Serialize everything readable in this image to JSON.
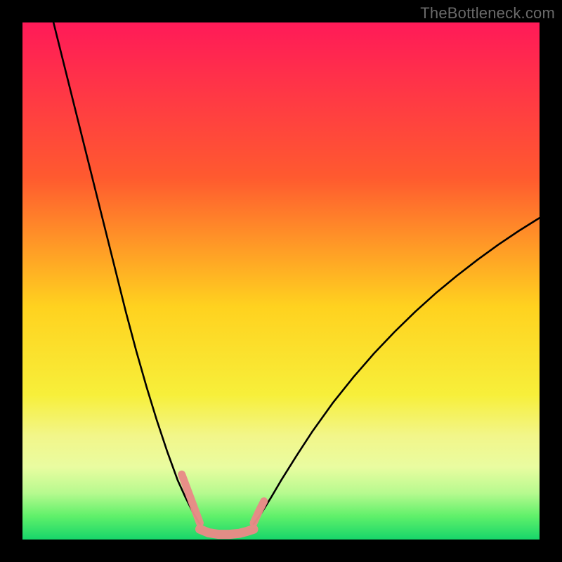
{
  "watermark": "TheBottleneck.com",
  "chart_data": {
    "type": "line",
    "title": "",
    "xlabel": "",
    "ylabel": "",
    "xlim": [
      0,
      100
    ],
    "ylim": [
      0,
      100
    ],
    "grid": false,
    "legend": false,
    "annotations": [],
    "background_gradient_stops": [
      {
        "offset": 0.0,
        "color": "#ff1a58"
      },
      {
        "offset": 0.3,
        "color": "#ff5a2f"
      },
      {
        "offset": 0.55,
        "color": "#ffd21f"
      },
      {
        "offset": 0.72,
        "color": "#f7ef3a"
      },
      {
        "offset": 0.8,
        "color": "#f2f68a"
      },
      {
        "offset": 0.86,
        "color": "#e9fca0"
      },
      {
        "offset": 0.91,
        "color": "#b7fa8f"
      },
      {
        "offset": 0.955,
        "color": "#5ff06a"
      },
      {
        "offset": 1.0,
        "color": "#17d66a"
      }
    ],
    "series": [
      {
        "name": "left-curve",
        "stroke": "#000000",
        "stroke_width": 2.6,
        "x": [
          6,
          8,
          10,
          12,
          14,
          16,
          18,
          20,
          22,
          24,
          26,
          28,
          30,
          31.5,
          33,
          34.3
        ],
        "y": [
          100,
          92,
          84,
          76,
          68,
          60,
          52,
          44,
          36.5,
          29.5,
          23,
          17,
          11.5,
          8.2,
          5.2,
          3.0
        ]
      },
      {
        "name": "right-curve",
        "stroke": "#000000",
        "stroke_width": 2.6,
        "x": [
          44.7,
          46,
          48,
          50,
          53,
          56,
          60,
          64,
          68,
          72,
          76,
          80,
          84,
          88,
          92,
          96,
          100
        ],
        "y": [
          3.0,
          4.8,
          8.0,
          11.4,
          16.2,
          20.8,
          26.4,
          31.4,
          36.0,
          40.2,
          44.1,
          47.7,
          51.0,
          54.1,
          57.0,
          59.7,
          62.2
        ]
      },
      {
        "name": "curve-dip-cap-left",
        "kind": "marker-stroke",
        "stroke": "#e88a87",
        "stroke_width": 11,
        "linecap": "round",
        "x": [
          30.8,
          32.0,
          33.3,
          34.3
        ],
        "y": [
          12.6,
          9.4,
          5.9,
          3.2
        ]
      },
      {
        "name": "curve-dip-cap-right",
        "kind": "marker-stroke",
        "stroke": "#e88a87",
        "stroke_width": 11,
        "linecap": "round",
        "x": [
          44.7,
          45.7,
          46.7
        ],
        "y": [
          3.2,
          5.4,
          7.4
        ]
      },
      {
        "name": "trough-floor",
        "kind": "marker-stroke",
        "stroke": "#e88a87",
        "stroke_width": 13,
        "linecap": "round",
        "x": [
          34.3,
          36.0,
          38.0,
          40.0,
          42.0,
          43.5,
          44.7
        ],
        "y": [
          2.0,
          1.3,
          1.0,
          1.0,
          1.2,
          1.6,
          2.0
        ]
      }
    ]
  }
}
